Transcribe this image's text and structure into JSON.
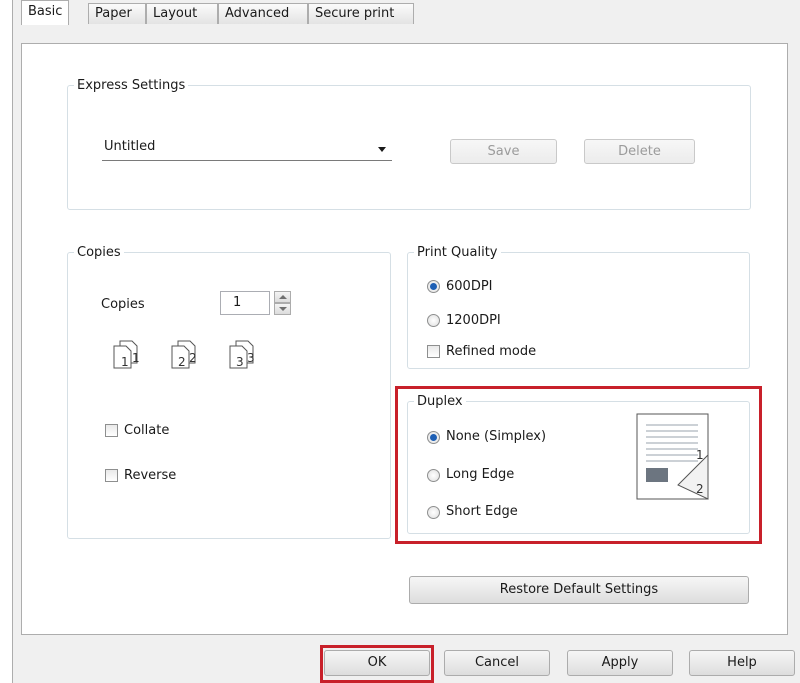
{
  "tabs": [
    "Basic",
    "Paper",
    "Layout",
    "Advanced",
    "Secure print"
  ],
  "express": {
    "legend": "Express Settings",
    "selected": "Untitled",
    "save_label": "Save",
    "delete_label": "Delete"
  },
  "copies": {
    "legend": "Copies",
    "label": "Copies",
    "value": "1",
    "collate_label": "Collate",
    "collate_checked": false,
    "reverse_label": "Reverse",
    "reverse_checked": false,
    "sheet_numbers": [
      "1",
      "1",
      "2",
      "2",
      "3",
      "3"
    ]
  },
  "print_quality": {
    "legend": "Print Quality",
    "options": [
      "600DPI",
      "1200DPI"
    ],
    "selected": "600DPI",
    "refined_label": "Refined mode",
    "refined_checked": false
  },
  "duplex": {
    "legend": "Duplex",
    "options": [
      "None (Simplex)",
      "Long Edge",
      "Short Edge"
    ],
    "selected": "None (Simplex)",
    "preview_numbers": [
      "1",
      "2"
    ]
  },
  "restore_label": "Restore Default Settings",
  "footer": {
    "ok": "OK",
    "cancel": "Cancel",
    "apply": "Apply",
    "help": "Help"
  },
  "colors": {
    "highlight": "#c8202a",
    "radio_selected": "#1e5fb4"
  }
}
